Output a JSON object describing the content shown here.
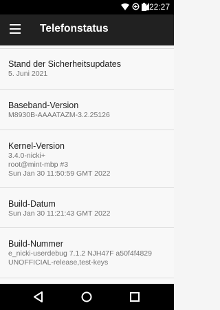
{
  "status": {
    "time": "22:27"
  },
  "app_bar": {
    "title": "Telefonstatus"
  },
  "items": [
    {
      "title": "Stand der Sicherheitsupdates",
      "sub": [
        "5. Juni 2021"
      ]
    },
    {
      "title": "Baseband-Version",
      "sub": [
        "M8930B-AAAATAZM-3.2.25126"
      ]
    },
    {
      "title": "Kernel-Version",
      "sub": [
        "3.4.0-nicki+",
        "root@mint-mbp #3",
        "Sun Jan 30 11:50:59 GMT 2022"
      ]
    },
    {
      "title": "Build-Datum",
      "sub": [
        "Sun Jan 30 11:21:43 GMT 2022"
      ]
    },
    {
      "title": "Build-Nummer",
      "sub": [
        "e_nicki-userdebug 7.1.2 NJH47F a50f4f4829",
        "UNOFFICIAL-release,test-keys"
      ]
    }
  ],
  "colors": {
    "app_bar": "#212121",
    "status_bar": "#000000",
    "background": "#f8f8f8"
  }
}
